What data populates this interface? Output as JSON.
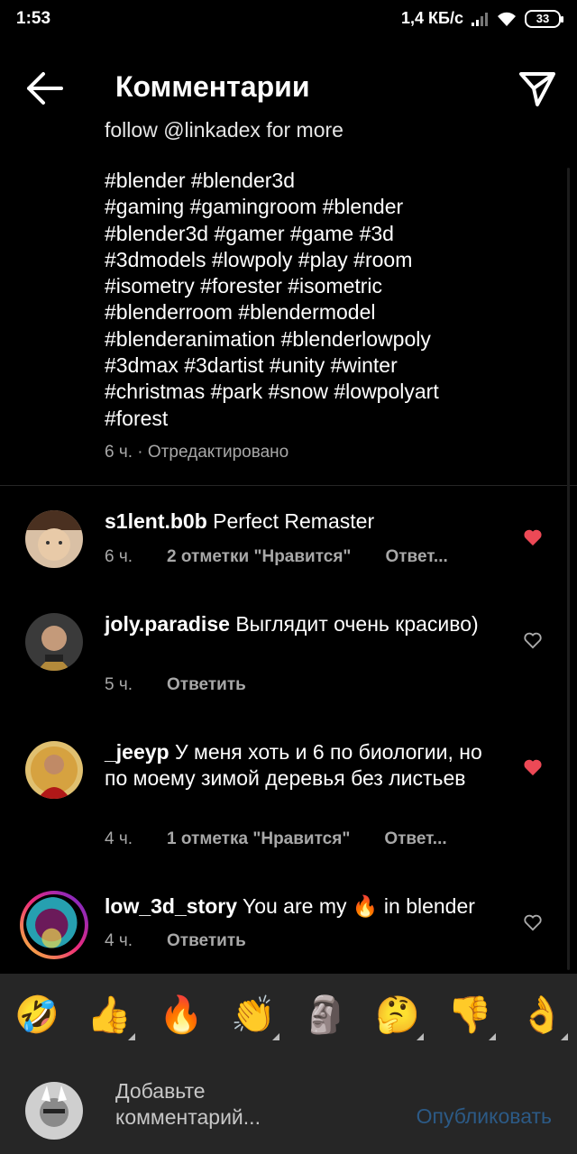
{
  "status": {
    "time": "1:53",
    "speed": "1,4 КБ/с",
    "battery": "33"
  },
  "header": {
    "title": "Комментарии"
  },
  "caption": {
    "cut_line": "follow @linkadex for more",
    "tags": "#blender #blender3d\n#gaming #gamingroom #blender\n#blender3d #gamer #game #3d\n#3dmodels #lowpoly #play #room\n#isometry #forester #isometric\n#blenderroom #blendermodel\n#blenderanimation #blenderlowpoly\n#3dmax #3dartist #unity #winter\n#christmas #park #snow #lowpolyart\n#forest",
    "meta": "6 ч. · Отредактировано"
  },
  "comments": [
    {
      "user": "s1lent.b0b",
      "text": "Perfect Remaster",
      "time": "6 ч.",
      "likes": "2 отметки \"Нравится\"",
      "reply": "Ответ...",
      "liked": true
    },
    {
      "user": "joly.paradise",
      "text": "Выглядит очень красиво)",
      "time": "5 ч.",
      "likes": "",
      "reply": "Ответить",
      "liked": false
    },
    {
      "user": "_jeeyp",
      "text": "У меня хоть и 6 по биологии, но по моему зимой деревья без листьев",
      "time": "4 ч.",
      "likes": "1 отметка \"Нравится\"",
      "reply": "Ответ...",
      "liked": true
    },
    {
      "user": "low_3d_story",
      "text_before": "You are my",
      "emoji": "🔥",
      "text_after": "in blender",
      "time": "4 ч.",
      "likes": "",
      "reply": "Ответить",
      "liked": false
    }
  ],
  "emojis": [
    "🤣",
    "👍",
    "🔥",
    "👏",
    "🗿",
    "🤔",
    "👎",
    "👌"
  ],
  "input": {
    "placeholder": "Добавьте комментарий...",
    "publish": "Опубликовать"
  },
  "colors": {
    "heart_liked": "#ed4956",
    "publish_disabled": "#2c5a86",
    "bar_bg": "#262626"
  }
}
